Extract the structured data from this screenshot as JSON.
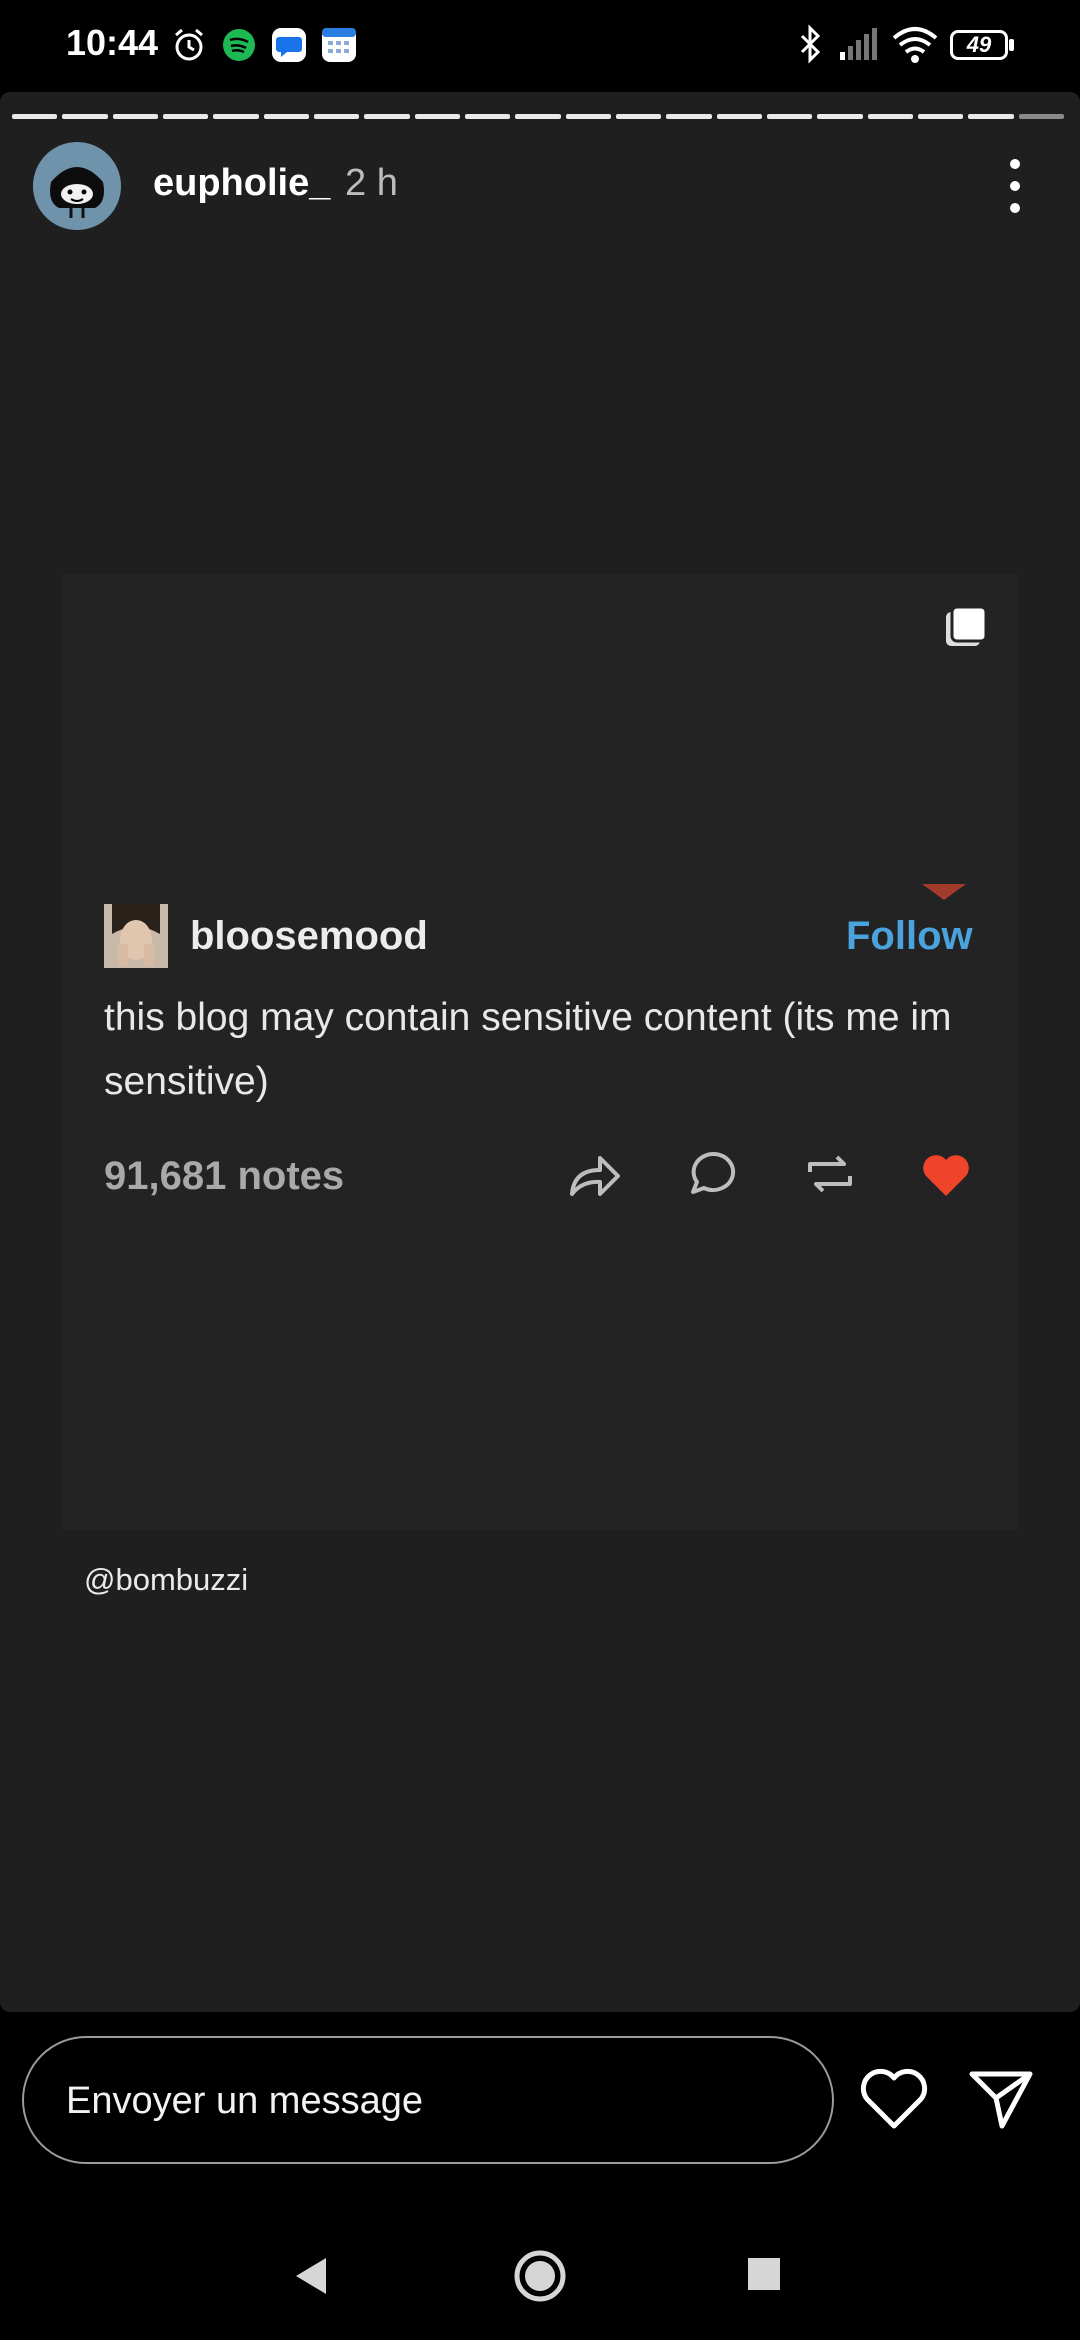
{
  "status_bar": {
    "time": "10:44",
    "battery": "49",
    "icons": [
      "alarm-icon",
      "spotify-icon",
      "messages-icon",
      "calendar-icon",
      "bluetooth-icon",
      "signal-icon",
      "wifi-icon",
      "battery-icon"
    ]
  },
  "story": {
    "progress_segments": 21,
    "username": "eupholie_",
    "time_ago": "2 h",
    "credit": "@bombuzzi"
  },
  "post": {
    "blog_name": "bloosemood",
    "follow_label": "Follow",
    "text": "this blog may contain sensitive content (its me im sensitive)",
    "notes": "91,681 notes",
    "colors": {
      "follow": "#4aa3dc",
      "like": "#f0442a"
    }
  },
  "reply": {
    "placeholder": "Envoyer un message"
  },
  "nav": {
    "icons": [
      "back-icon",
      "home-icon",
      "recents-icon"
    ]
  }
}
